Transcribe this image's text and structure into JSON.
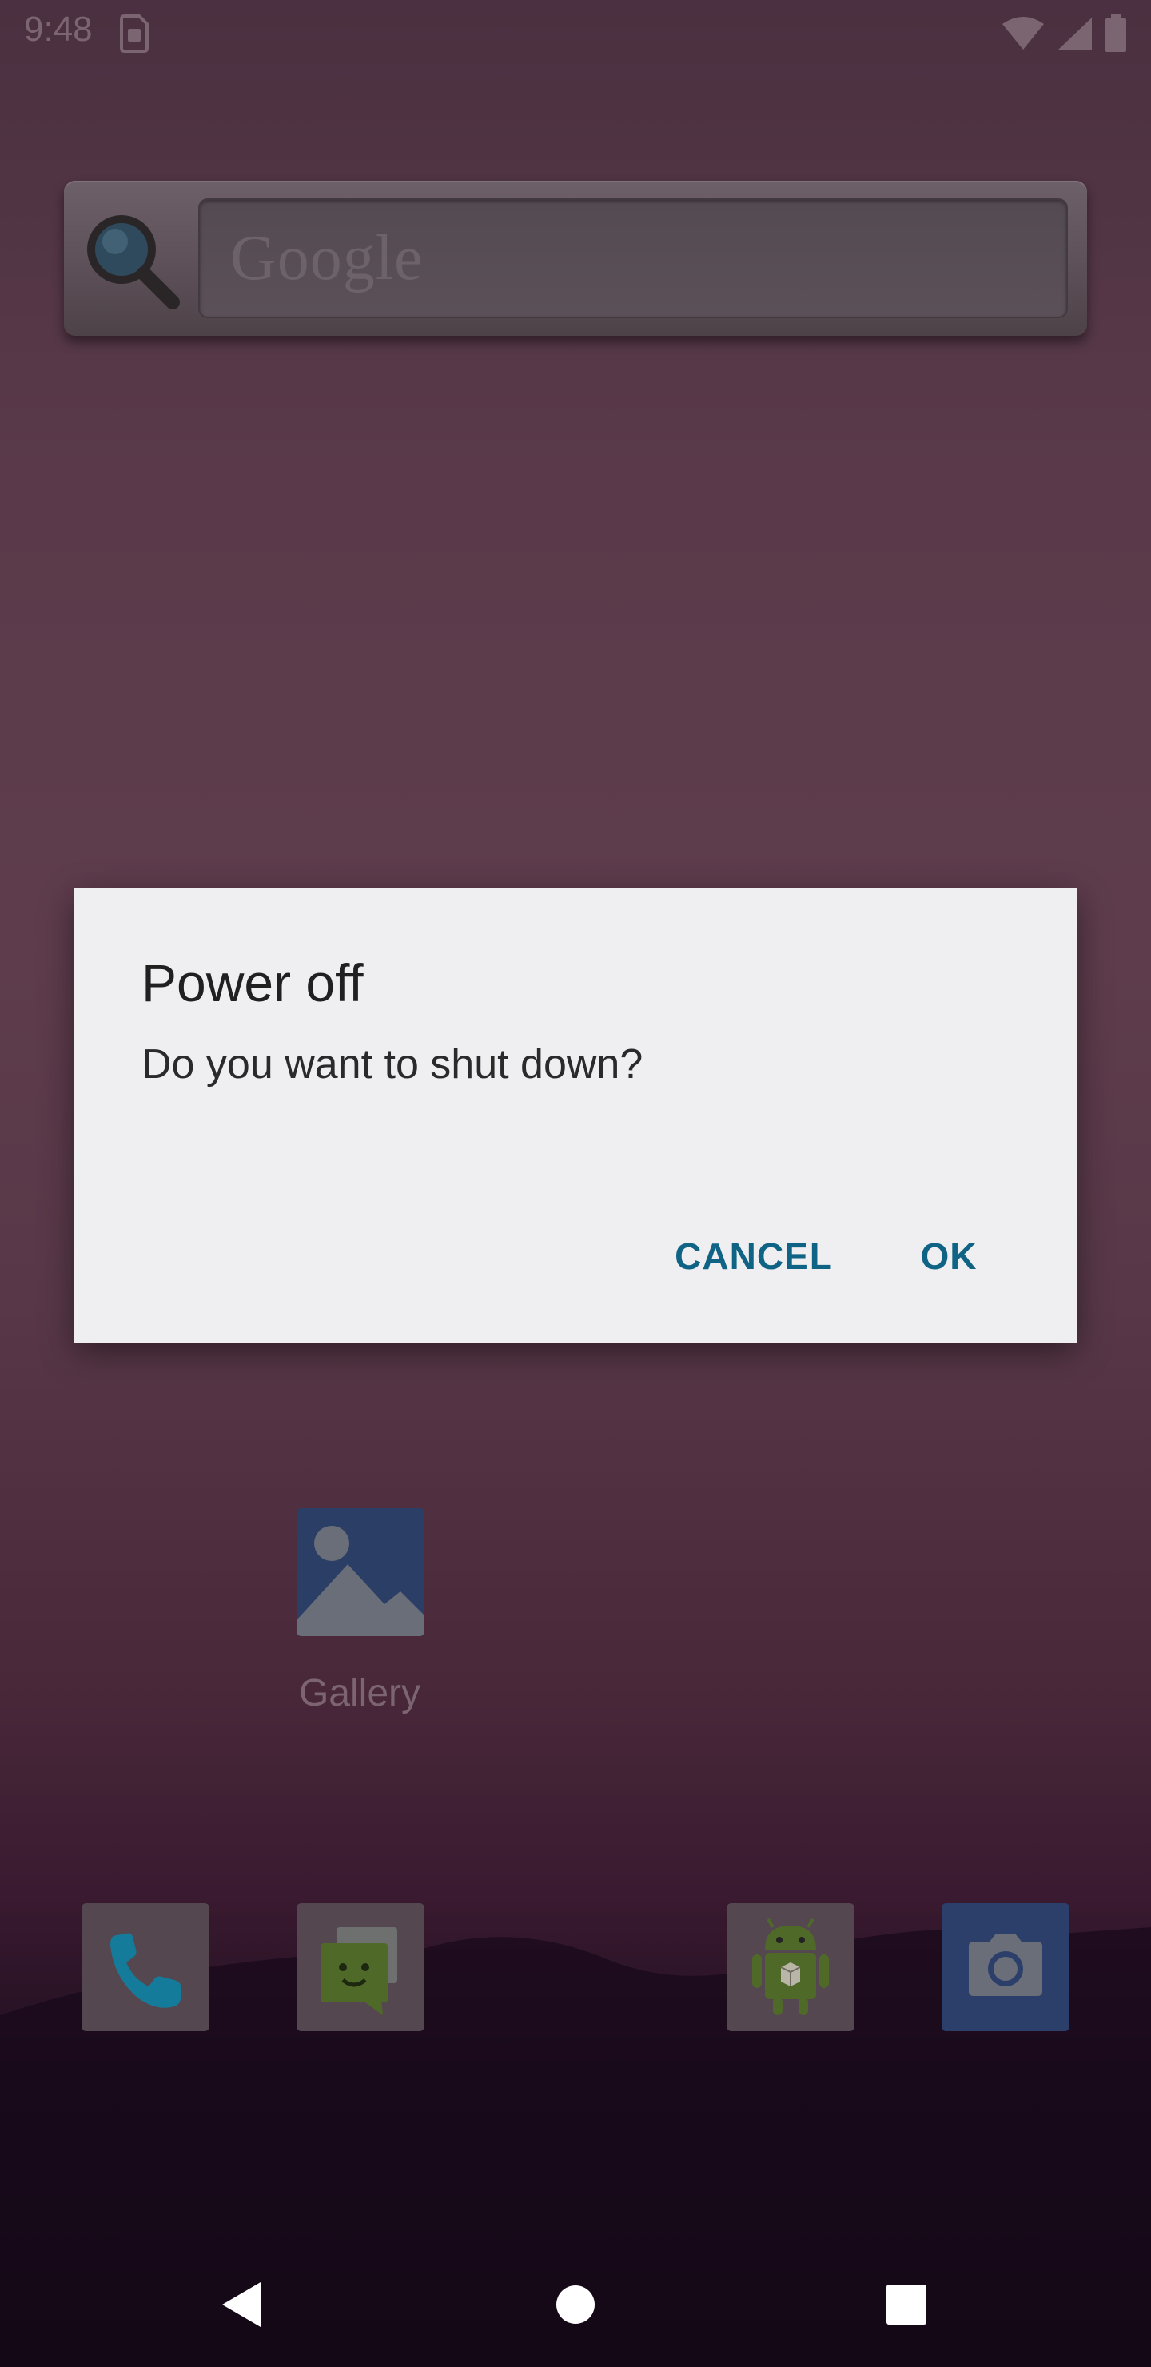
{
  "status_bar": {
    "time": "9:48",
    "icons": [
      "sim-card-icon",
      "wifi-icon",
      "cell-signal-icon",
      "battery-icon"
    ]
  },
  "search_widget": {
    "placeholder": "Google"
  },
  "home": {
    "gallery_label": "Gallery"
  },
  "dock": [
    {
      "name": "phone",
      "icon": "phone-icon"
    },
    {
      "name": "messages",
      "icon": "messages-icon"
    },
    {
      "name": "android",
      "icon": "android-icon"
    },
    {
      "name": "camera",
      "icon": "camera-icon"
    }
  ],
  "dialog": {
    "title": "Power off",
    "message": "Do you want to shut down?",
    "cancel_label": "CANCEL",
    "ok_label": "OK",
    "accent_color": "#0f6384"
  },
  "nav_bar": {
    "buttons": [
      "back-icon",
      "home-icon",
      "recents-icon"
    ]
  }
}
